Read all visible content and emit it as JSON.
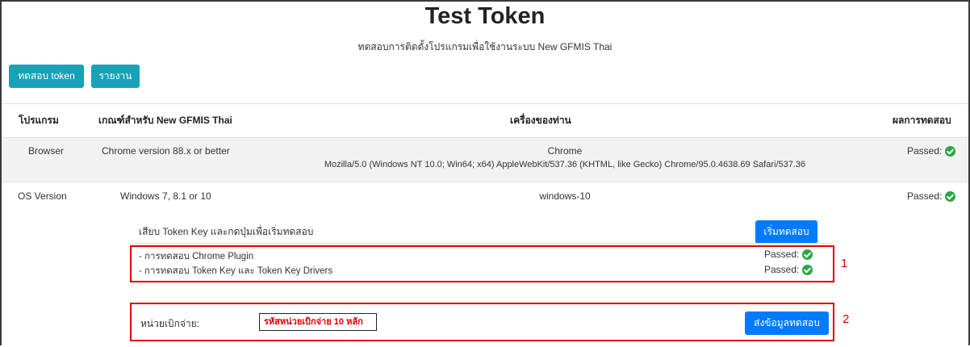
{
  "page": {
    "title": "Test Token",
    "subtitle": "ทดสอบการติดตั้งโปรแกรมเพื่อใช้งานระบบ New GFMIS Thai"
  },
  "toolbar": {
    "test_token_label": "ทดสอบ token",
    "report_label": "รายงาน"
  },
  "table": {
    "headers": {
      "program": "โปรแกรม",
      "criteria": "เกณฑ์สำหรับ New GFMIS Thai",
      "your_machine": "เครื่องของท่าน",
      "result": "ผลการทดสอบ"
    },
    "rows": [
      {
        "program": "Browser",
        "criteria": "Chrome version 88.x or better",
        "machine_primary": "Chrome",
        "machine_secondary": "Mozilla/5.0 (Windows NT 10.0; Win64; x64) AppleWebKit/537.36 (KHTML, like Gecko) Chrome/95.0.4638.69 Safari/537.36",
        "result": "Passed:"
      },
      {
        "program": "OS Version",
        "criteria": "Windows 7, 8.1 or 10",
        "machine_primary": "windows-10",
        "result": "Passed:"
      }
    ]
  },
  "token_test": {
    "instruction": "เสียบ Token Key และกดปุ่มเพื่อเริ่มทดสอบ",
    "start_button": "เริ่มทดสอบ",
    "items": [
      {
        "label": "- การทดสอบ Chrome Plugin",
        "result": "Passed:"
      },
      {
        "label": "- การทดสอบ Token Key และ Token Key Drivers",
        "result": "Passed:"
      }
    ],
    "annotation_1": "1"
  },
  "submit_section": {
    "unit_label": "หน่วยเบิกจ่าย:",
    "unit_placeholder": "รหัสหน่วยเบิกจ่าย 10 หลัก",
    "submit_button": "ส่งข้อมูลทดสอบ",
    "annotation_2": "2"
  },
  "colors": {
    "teal_button": "#17a2b8",
    "blue_button": "#007bff",
    "passed_icon": "#28a745",
    "highlight_red": "#e00000"
  }
}
